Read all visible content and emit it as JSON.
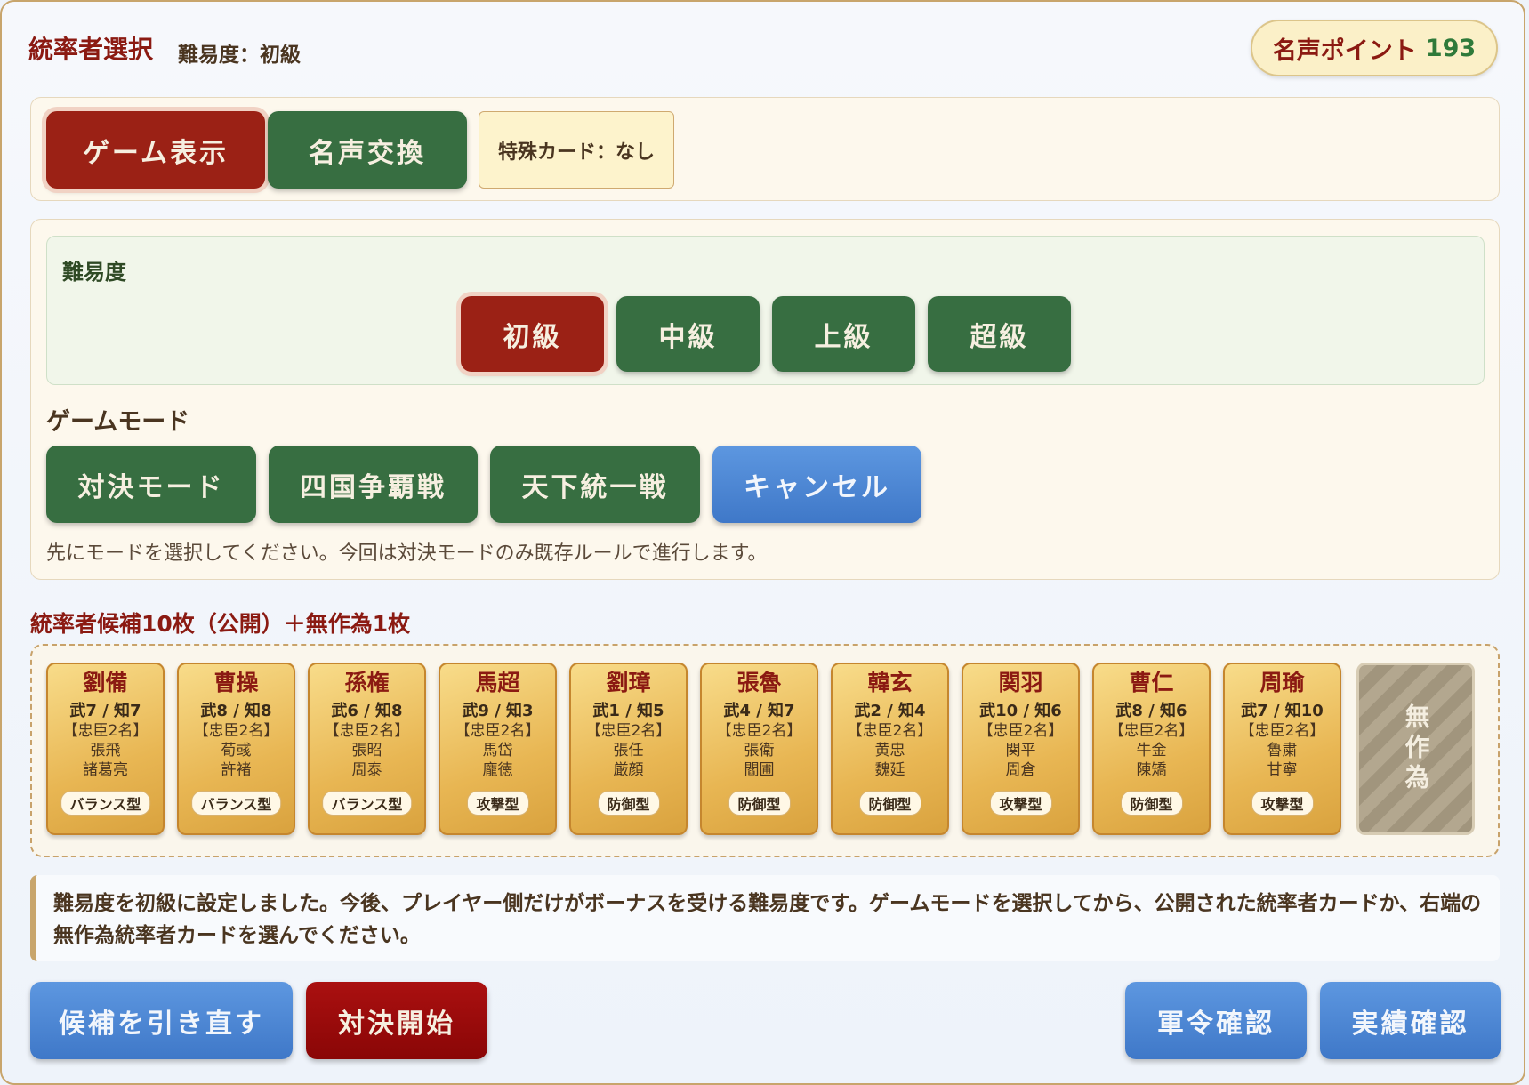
{
  "header": {
    "title": "統率者選択",
    "difficulty_text": "難易度：初級",
    "fame_label": "名声ポイント",
    "fame_value": "193"
  },
  "top_actions": {
    "game_display": "ゲーム表示",
    "fame_exchange": "名声交換",
    "special_card": "特殊カード：なし"
  },
  "difficulty": {
    "heading": "難易度",
    "options": [
      "初級",
      "中級",
      "上級",
      "超級"
    ],
    "selected": "初級"
  },
  "game_mode": {
    "heading": "ゲームモード",
    "options": [
      "対決モード",
      "四国争覇戦",
      "天下統一戦"
    ],
    "cancel": "キャンセル",
    "note": "先にモードを選択してください。今回は対決モードのみ既存ルールで進行します。"
  },
  "candidates": {
    "heading": "統率者候補10枚（公開）＋無作為1枚",
    "cards": [
      {
        "name": "劉備",
        "stats": "武7 / 知7",
        "vassals_label": "【忠臣2名】",
        "vassal1": "張飛",
        "vassal2": "諸葛亮",
        "type": "バランス型"
      },
      {
        "name": "曹操",
        "stats": "武8 / 知8",
        "vassals_label": "【忠臣2名】",
        "vassal1": "荀彧",
        "vassal2": "許褚",
        "type": "バランス型"
      },
      {
        "name": "孫権",
        "stats": "武6 / 知8",
        "vassals_label": "【忠臣2名】",
        "vassal1": "張昭",
        "vassal2": "周泰",
        "type": "バランス型"
      },
      {
        "name": "馬超",
        "stats": "武9 / 知3",
        "vassals_label": "【忠臣2名】",
        "vassal1": "馬岱",
        "vassal2": "龐徳",
        "type": "攻撃型"
      },
      {
        "name": "劉璋",
        "stats": "武1 / 知5",
        "vassals_label": "【忠臣2名】",
        "vassal1": "張任",
        "vassal2": "厳顔",
        "type": "防御型"
      },
      {
        "name": "張魯",
        "stats": "武4 / 知7",
        "vassals_label": "【忠臣2名】",
        "vassal1": "張衛",
        "vassal2": "閻圃",
        "type": "防御型"
      },
      {
        "name": "韓玄",
        "stats": "武2 / 知4",
        "vassals_label": "【忠臣2名】",
        "vassal1": "黄忠",
        "vassal2": "魏延",
        "type": "防御型"
      },
      {
        "name": "関羽",
        "stats": "武10 / 知6",
        "vassals_label": "【忠臣2名】",
        "vassal1": "関平",
        "vassal2": "周倉",
        "type": "攻撃型"
      },
      {
        "name": "曹仁",
        "stats": "武8 / 知6",
        "vassals_label": "【忠臣2名】",
        "vassal1": "牛金",
        "vassal2": "陳矯",
        "type": "防御型"
      },
      {
        "name": "周瑜",
        "stats": "武7 / 知10",
        "vassals_label": "【忠臣2名】",
        "vassal1": "魯粛",
        "vassal2": "甘寧",
        "type": "攻撃型"
      }
    ],
    "random_card": "無作為"
  },
  "message": "難易度を初級に設定しました。今後、プレイヤー側だけがボーナスを受ける難易度です。ゲームモードを選択してから、公開された統率者カードか、右端の無作為統率者カードを選んでください。",
  "bottom_actions": {
    "redraw": "候補を引き直す",
    "start": "対決開始",
    "orders": "軍令確認",
    "records": "実績確認"
  },
  "colors": {
    "accent_red": "#9b2115",
    "accent_green": "#376e41",
    "accent_blue": "#4a86d4",
    "card_gold": "#e8b653"
  }
}
